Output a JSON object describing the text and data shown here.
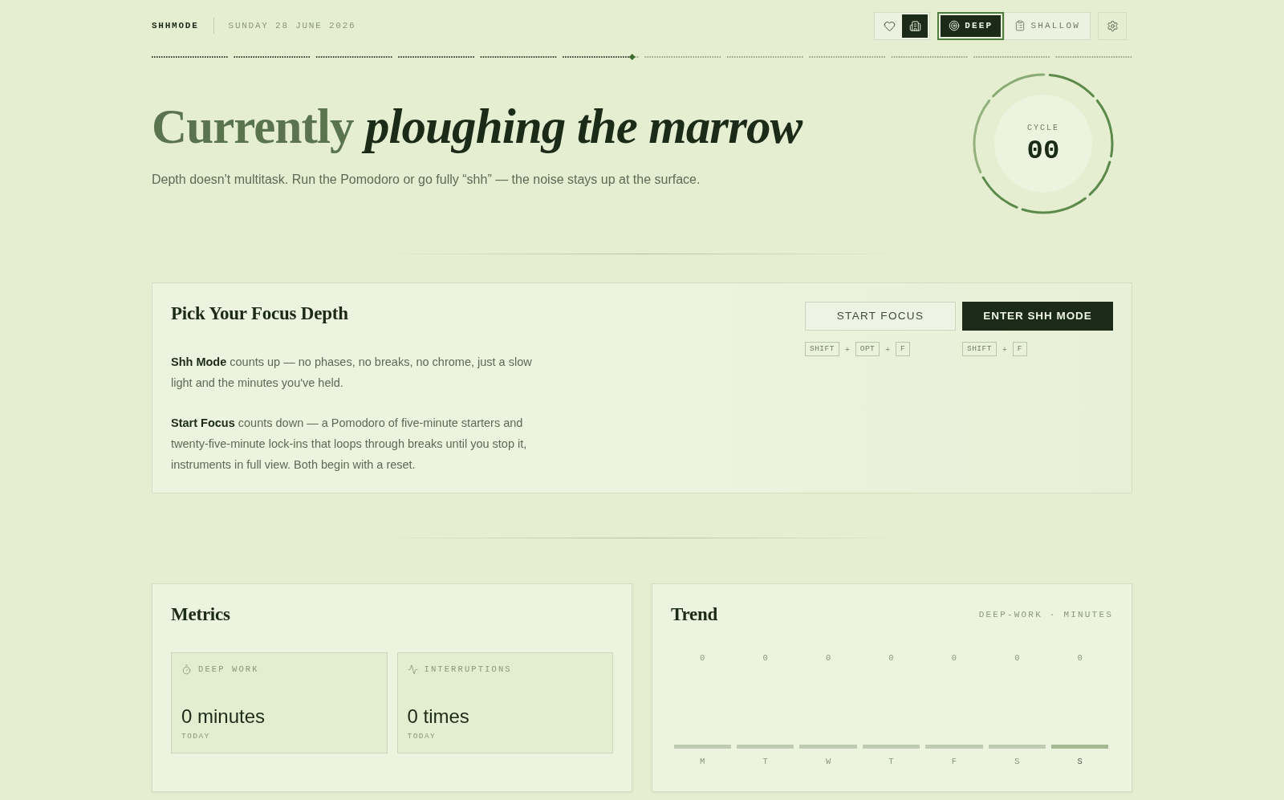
{
  "header": {
    "brand": "SHHMODE",
    "date": "SUNDAY 28 JUNE 2026",
    "view_toggle": [
      {
        "kind": "heart",
        "selected": false
      },
      {
        "kind": "building",
        "selected": true
      }
    ],
    "mode_switch": [
      {
        "kind": "target",
        "label": "DEEP",
        "selected": true
      },
      {
        "kind": "clipboard",
        "label": "SHALLOW",
        "selected": false
      }
    ]
  },
  "day_progress": {
    "level": 0.49
  },
  "hero": {
    "title": "Currently *ploughing the marrow*",
    "subtitle": "Depth doesn't multitask. Run the Pomodoro or go fully “shh” — the noise stays up at the surface.",
    "cycle": {
      "label": "CYCLE",
      "value": "00"
    }
  },
  "focus_card": {
    "title": "Pick Your Focus Depth",
    "paragraphs": [
      "**Shh Mode** counts up — no phases, no breaks, no chrome, just a slow light and the minutes you've held.",
      "**Start Focus** counts down — a Pomodoro of five-minute starters and twenty-five-minute lock-ins that loops through breaks until you stop it, instruments in full view. Both begin with a reset."
    ],
    "actions": [
      {
        "kind": "outline",
        "label": "START FOCUS",
        "keys": [
          "SHIFT",
          "OPT",
          "F"
        ],
        "separator": "+"
      },
      {
        "kind": "solid",
        "label": "ENTER SHH MODE",
        "keys": [
          "SHIFT",
          "F"
        ],
        "separator": "+"
      }
    ]
  },
  "metrics": {
    "title": "Metrics",
    "tiles": [
      {
        "kind": "timer",
        "label": "DEEP WORK",
        "value": "0 minutes",
        "caption": "TODAY"
      },
      {
        "kind": "pulse",
        "label": "INTERRUPTIONS",
        "value": "0 times",
        "caption": "TODAY"
      }
    ]
  },
  "trend": {
    "title": "Trend",
    "caption": "DEEP-WORK · MINUTES",
    "days": [
      {
        "value": "0",
        "label": "M",
        "selected": false
      },
      {
        "value": "0",
        "label": "T",
        "selected": false
      },
      {
        "value": "0",
        "label": "W",
        "selected": false
      },
      {
        "value": "0",
        "label": "T",
        "selected": false
      },
      {
        "value": "0",
        "label": "F",
        "selected": false
      },
      {
        "value": "0",
        "label": "S",
        "selected": false
      },
      {
        "value": "0",
        "label": "S",
        "selected": true
      }
    ]
  }
}
